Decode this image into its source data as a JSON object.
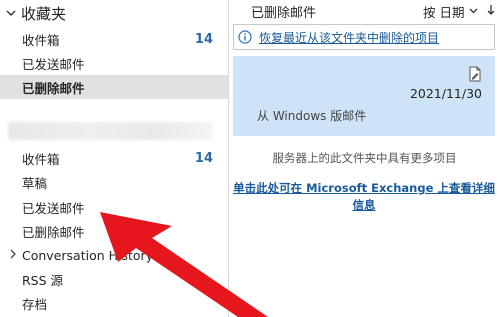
{
  "sidebar": {
    "favorites_header": "收藏夹",
    "favorites": [
      {
        "label": "收件箱",
        "count": "14"
      },
      {
        "label": "已发送邮件",
        "count": ""
      },
      {
        "label": "已删除邮件",
        "count": "",
        "selected": true
      }
    ],
    "account_items": [
      {
        "label": "收件箱",
        "count": "14"
      },
      {
        "label": "草稿",
        "count": ""
      },
      {
        "label": "已发送邮件",
        "count": ""
      },
      {
        "label": "已删除邮件",
        "count": ""
      },
      {
        "label": "Conversation History",
        "count": "",
        "expandable": true
      },
      {
        "label": "RSS 源",
        "count": ""
      },
      {
        "label": "存档",
        "count": ""
      }
    ]
  },
  "main": {
    "folder_title": "已删除邮件",
    "sort_label": "按 日期",
    "restore_link": "恢复最近从该文件夹中删除的项目",
    "message": {
      "date": "2021/11/30",
      "preview": "从 Windows 版邮件"
    },
    "server_note": "服务器上的此文件夹中具有更多项目",
    "exchange_link": "单击此处可在 Microsoft Exchange 上查看详细信息"
  },
  "colors": {
    "selected_row": "#e1e1e1",
    "selected_message": "#cfe3f7",
    "link": "#1a5a9a",
    "count": "#2c6aa5",
    "annotation_arrow": "#e5161c"
  },
  "icons": {
    "favorites_toggle": "chevron-down-icon",
    "sort_toggle": "chevron-down-icon",
    "sort_direction": "arrow-down-icon",
    "restore": "info-icon",
    "draft": "draft-icon",
    "expand": "chevron-right-icon"
  }
}
